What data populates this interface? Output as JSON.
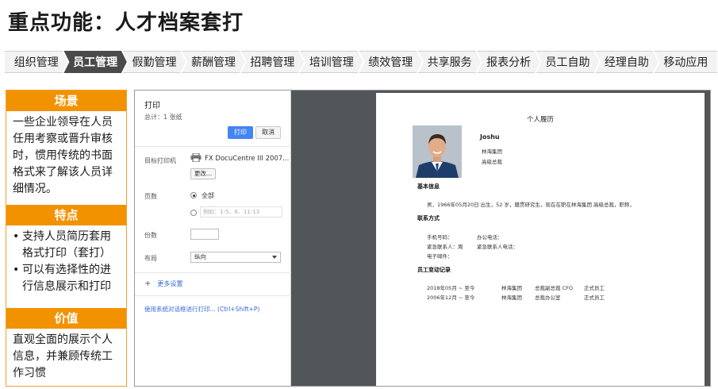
{
  "title": "重点功能：人才档案套打",
  "nav": {
    "tabs": [
      "组织管理",
      "员工管理",
      "假勤管理",
      "薪酬管理",
      "招聘管理",
      "培训管理",
      "绩效管理",
      "共享服务",
      "报表分析",
      "员工自助",
      "经理自助",
      "移动应用"
    ],
    "active_index": 1
  },
  "left_panel": {
    "scene": {
      "heading": "场景",
      "text": "一些企业领导在人员任用考察或晋升审核时，惯用传统的书面格式来了解该人员详细情况。"
    },
    "features": {
      "heading": "特点",
      "items": [
        "支持人员简历套用格式打印（套打）",
        "可以有选择性的进行信息展示和打印"
      ]
    },
    "value": {
      "heading": "价值",
      "text": "直观全面的展示个人信息，并兼顾传统工作习惯"
    }
  },
  "print_dialog": {
    "title": "打印",
    "total": "总计：1 张纸",
    "print_button": "打印",
    "cancel_button": "取消",
    "target_label": "目标打印机",
    "printer_name": "FX DocuCentre III 2007...",
    "change_button": "更改...",
    "pages_label": "页数",
    "all_option": "全部",
    "pages_placeholder": "例如：1-5、8、11-13",
    "copies_label": "份数",
    "layout_label": "布局",
    "layout_value": "纵向",
    "more_settings": "更多设置",
    "system_dialog": "使用系统对话框进行打印... (Ctrl+Shift+P)"
  },
  "resume": {
    "title": "个人履历",
    "name": "Joshu",
    "org": "林海集团",
    "position": "高级总裁",
    "basic_title": "基本信息",
    "basic_text": "男，1966年05月20日 出生，52 岁，籍贯研究生，现在在职在林海集团 高级总裁，职称，",
    "contact_title": "联系方式",
    "mobile": "手机号码：",
    "office_phone": "办公电话：",
    "emergency_contact": "紧急联系人：周",
    "emergency_phone": "紧急联系人电话：",
    "email": "电子邮件：",
    "history_title": "员工变动记录",
    "history": [
      {
        "date": "2018年05月 ~ 至今",
        "org": "林海集团",
        "role": "总裁副总裁 CFO",
        "status": "正式员工"
      },
      {
        "date": "2006年12月 ~ 至今",
        "org": "林海集团",
        "role": "总裁办公室",
        "status": "正式员工"
      }
    ]
  },
  "colors": {
    "accent": "#f39200",
    "active_tab": "#4a4a4a",
    "print_blue": "#4285f4",
    "viewer_bg": "#525659"
  }
}
